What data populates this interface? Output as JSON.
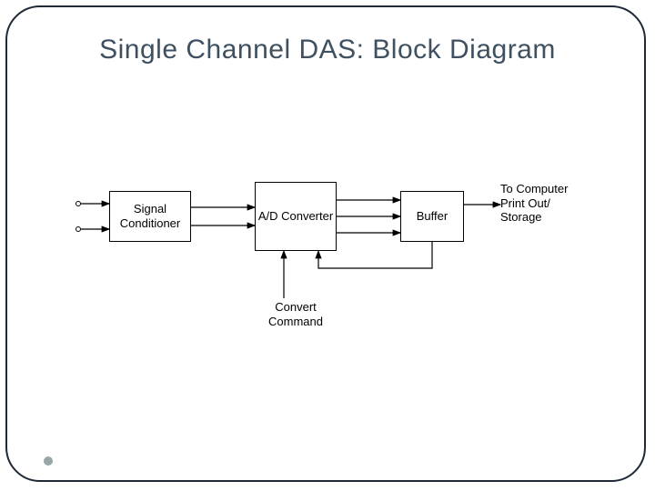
{
  "title": "Single Channel DAS: Block Diagram",
  "blocks": {
    "signal_conditioner": "Signal\nConditioner",
    "ad_converter": "A/D\nConverter",
    "buffer": "Buffer"
  },
  "labels": {
    "convert_command": "Convert\nCommand",
    "output": "To Computer\nPrint Out/\nStorage"
  },
  "connections": [
    {
      "from": "input-terminals",
      "to": "signal_conditioner",
      "count": 2
    },
    {
      "from": "signal_conditioner",
      "to": "ad_converter",
      "count": 2
    },
    {
      "from": "ad_converter",
      "to": "buffer",
      "count": 3
    },
    {
      "from": "buffer",
      "to": "output",
      "count": 1
    },
    {
      "from": "buffer",
      "to": "ad_converter",
      "note": "feedback",
      "count": 1
    },
    {
      "from": "convert_command",
      "to": "ad_converter",
      "count": 1
    }
  ]
}
